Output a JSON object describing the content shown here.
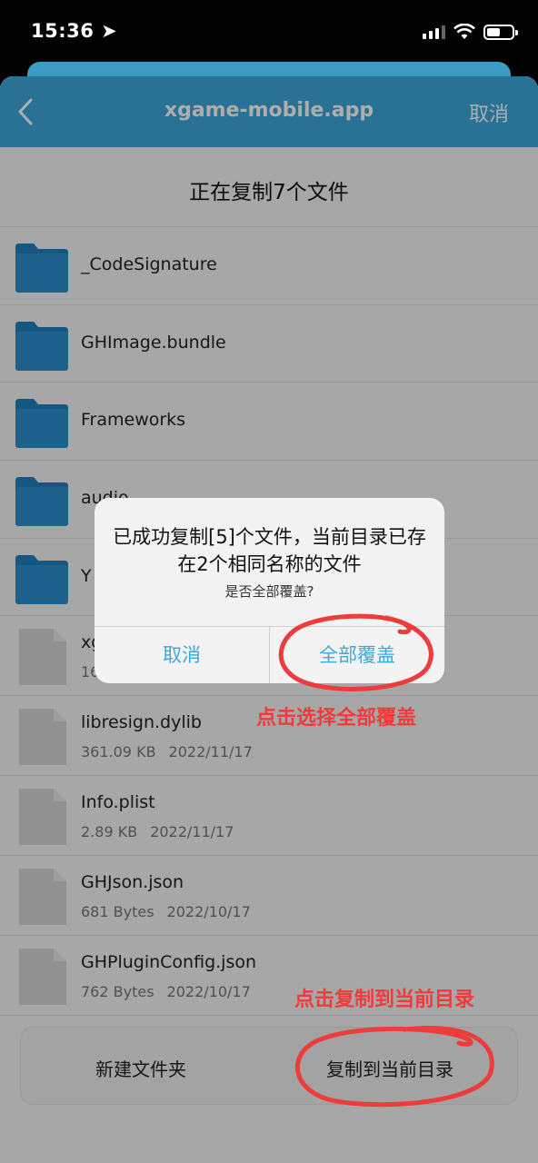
{
  "status_bar": {
    "time": "15:36"
  },
  "nav": {
    "title": "xgame-mobile.app",
    "cancel_label": "取消"
  },
  "copy_header": "正在复制7个文件",
  "folders": [
    {
      "name": "_CodeSignature"
    },
    {
      "name": "GHImage.bundle"
    },
    {
      "name": "Frameworks"
    },
    {
      "name": "audio"
    },
    {
      "name": "Y"
    }
  ],
  "files": [
    {
      "name": "xg",
      "size": "16",
      "date": ""
    },
    {
      "name": "libresign.dylib",
      "size": "361.09 KB",
      "date": "2022/11/17"
    },
    {
      "name": "Info.plist",
      "size": "2.89 KB",
      "date": "2022/11/17"
    },
    {
      "name": "GHJson.json",
      "size": "681 Bytes",
      "date": "2022/10/17"
    },
    {
      "name": "GHPluginConfig.json",
      "size": "762 Bytes",
      "date": "2022/10/17"
    }
  ],
  "bottom_bar": {
    "new_folder_label": "新建文件夹",
    "copy_here_label": "复制到当前目录"
  },
  "alert": {
    "title": "已成功复制[5]个文件，当前目录已存在2个相同名称的文件",
    "message": "是否全部覆盖?",
    "cancel_label": "取消",
    "overwrite_label": "全部覆盖"
  },
  "annotations": {
    "overwrite_hint": "点击选择全部覆盖",
    "copy_hint": "点击复制到当前目录"
  },
  "colors": {
    "accent": "#3ea7dd",
    "folder": "#1d80c0",
    "annotation": "#ee3b3b"
  }
}
